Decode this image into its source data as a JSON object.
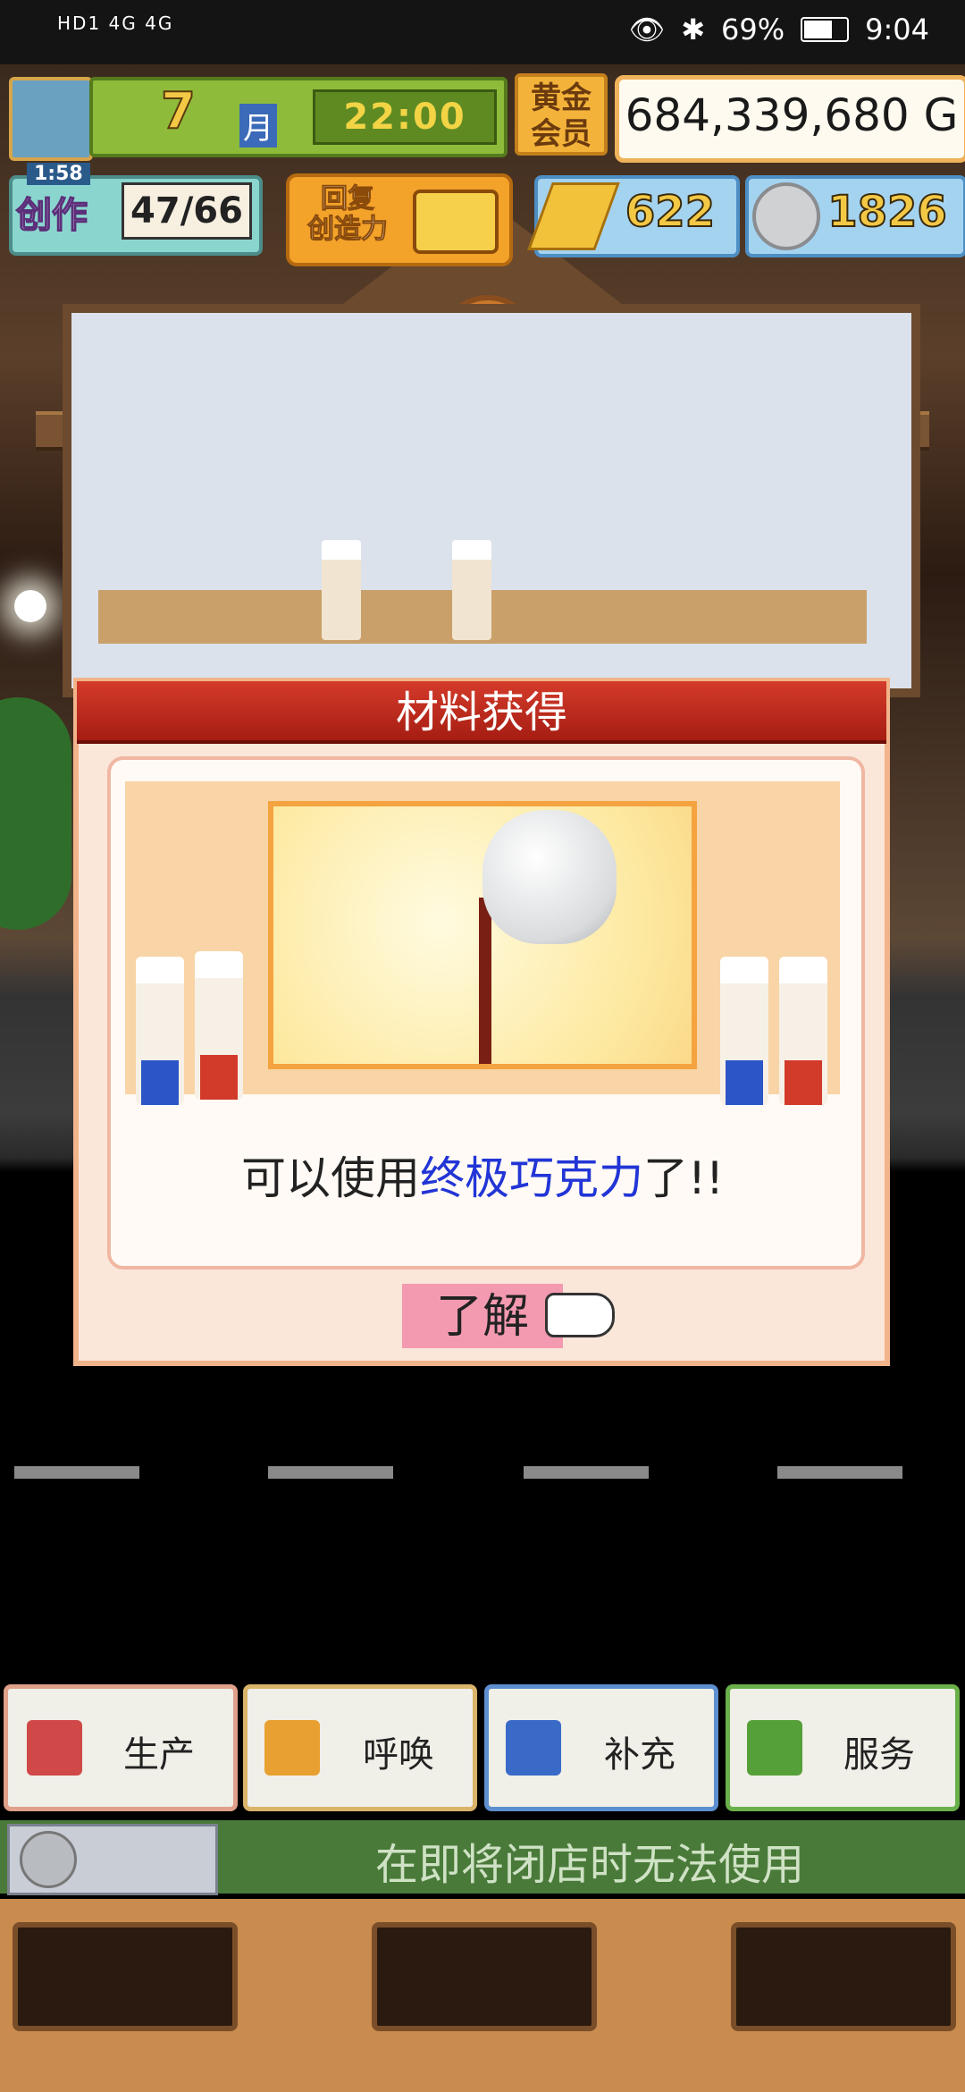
{
  "status_bar": {
    "left_text": "HD1 4G 4G",
    "battery": "69%",
    "battery_level": 0.69,
    "time": "9:04"
  },
  "hud": {
    "month_value": "7",
    "month_unit": "月",
    "clock": "22:00",
    "gold_member_badge": "黄金\n会员",
    "money": "684,339,680 G",
    "create_label": "创作",
    "create_count": "47/66",
    "create_timer": "1:58",
    "restore_label": "回复\n创造力",
    "gems": "622",
    "medals": "1826"
  },
  "dialog": {
    "title": "材料获得",
    "message_prefix": "可以使用",
    "message_highlight": "终极巧克力",
    "message_suffix": "了!!",
    "ok_label": "了解"
  },
  "menu": {
    "produce": "生产",
    "summon": "呼唤",
    "restock": "补充",
    "service": "服务"
  },
  "bottom_bar": {
    "message": "在即将闭店时无法使用"
  },
  "colors": {
    "dialog_title_red": "#c22b1d",
    "highlight_blue": "#2235d6",
    "ok_pink": "#f39ab0",
    "menu_produce_border": "#e0a08a",
    "menu_summon_border": "#d9b36a",
    "menu_restock_border": "#5d8fd0",
    "menu_service_border": "#6ab04a"
  },
  "icons": {
    "avatar": "chef-avatar-icon",
    "gem": "gold-bar-icon",
    "medal": "silver-medal-icon",
    "tv": "tv-icon",
    "hand": "pointing-hand-icon"
  }
}
